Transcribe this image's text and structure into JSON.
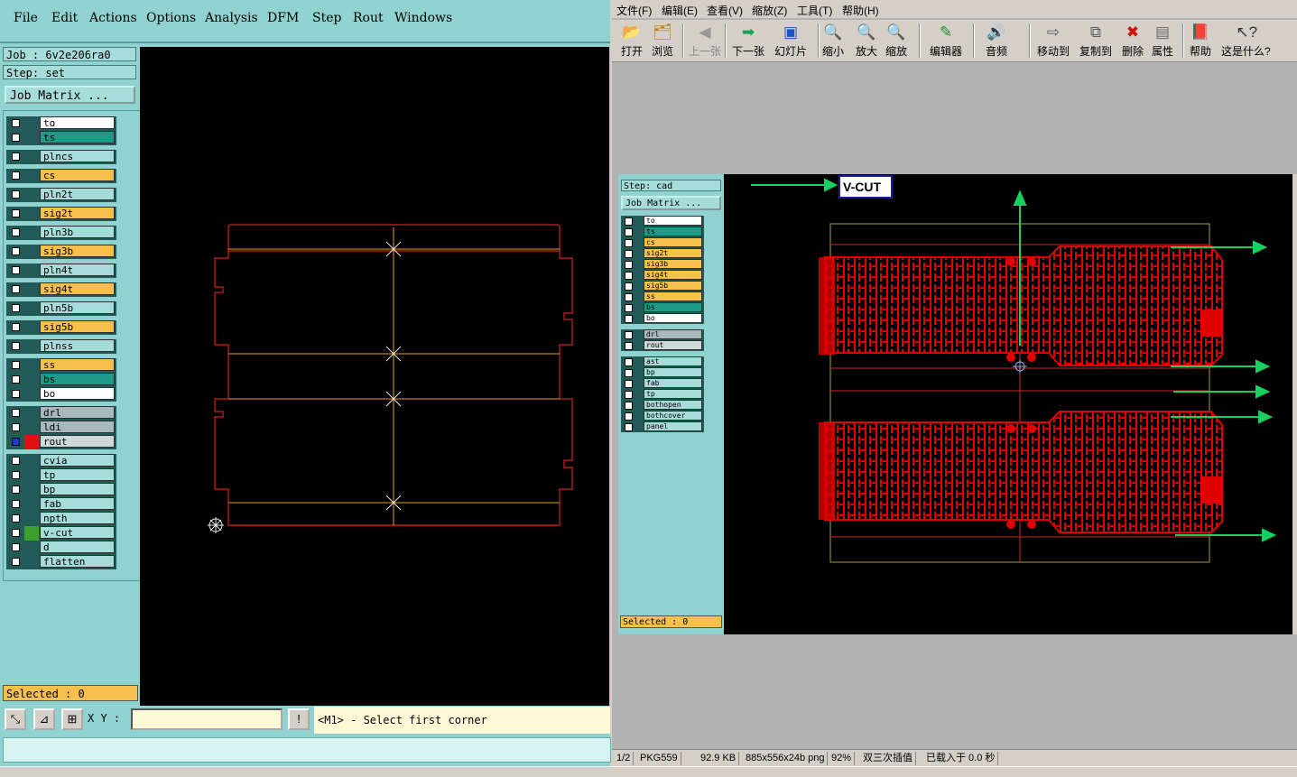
{
  "left_app": {
    "menu": [
      "File",
      "Edit",
      "Actions",
      "Options",
      "Analysis",
      "DFM",
      "Step",
      "Rout",
      "Windows"
    ],
    "job_line": "Job : 6v2e206ra0",
    "step_line": "Step: set",
    "job_matrix_button": "Job Matrix ...",
    "layer_groups": [
      [
        {
          "name": "to",
          "color": "#ffffff"
        },
        {
          "name": "ts",
          "color": "#1e9a86"
        }
      ],
      [
        {
          "name": "plncs",
          "color": "#a6dcda"
        }
      ],
      [
        {
          "name": "cs",
          "color": "#f7c04c"
        }
      ],
      [
        {
          "name": "pln2t",
          "color": "#a6dcda"
        }
      ],
      [
        {
          "name": "sig2t",
          "color": "#f7c04c"
        }
      ],
      [
        {
          "name": "pln3b",
          "color": "#a6dcda"
        }
      ],
      [
        {
          "name": "sig3b",
          "color": "#f7c04c"
        }
      ],
      [
        {
          "name": "pln4t",
          "color": "#a6dcda"
        }
      ],
      [
        {
          "name": "sig4t",
          "color": "#f7c04c"
        }
      ],
      [
        {
          "name": "pln5b",
          "color": "#a6dcda"
        }
      ],
      [
        {
          "name": "sig5b",
          "color": "#f7c04c"
        }
      ],
      [
        {
          "name": "plnss",
          "color": "#a6dcda"
        }
      ],
      [
        {
          "name": "ss",
          "color": "#f7c04c"
        },
        {
          "name": "bs",
          "color": "#1e9a86"
        },
        {
          "name": "bo",
          "color": "#ffffff"
        }
      ],
      [
        {
          "name": "drl",
          "color": "#a9b8bc"
        },
        {
          "name": "ldi",
          "color": "#a9b8bc"
        },
        {
          "name": "rout",
          "color": "#cfd8d8",
          "active": true
        }
      ],
      [
        {
          "name": "cvia",
          "color": "#a6dcda"
        },
        {
          "name": "tp",
          "color": "#a6dcda"
        },
        {
          "name": "bp",
          "color": "#a6dcda"
        },
        {
          "name": "fab",
          "color": "#a6dcda"
        },
        {
          "name": "npth",
          "color": "#a6dcda"
        },
        {
          "name": "v-cut",
          "color": "#a6dcda",
          "marker": "#3aa02a"
        },
        {
          "name": "d",
          "color": "#a6dcda"
        },
        {
          "name": "flatten",
          "color": "#a6dcda"
        }
      ]
    ],
    "selected_text": "Selected : 0",
    "xy_label": "X Y :",
    "exclaim": "!",
    "prompt_text": "<M1> - Select first corner"
  },
  "viewer": {
    "menu": [
      "文件(F)",
      "编辑(E)",
      "查看(V)",
      "缩放(Z)",
      "工具(T)",
      "帮助(H)"
    ],
    "toolbar": [
      {
        "label": "打开",
        "icon": "folder-open-icon",
        "glyph": "📂"
      },
      {
        "label": "浏览",
        "icon": "browse-icon",
        "glyph": "🗂"
      },
      {
        "label": "上一张",
        "icon": "prev-icon",
        "glyph": "◀",
        "disabled": true
      },
      {
        "label": "下一张",
        "icon": "next-icon",
        "glyph": "➡"
      },
      {
        "label": "幻灯片",
        "icon": "slideshow-icon",
        "glyph": "▣"
      },
      {
        "label": "缩小",
        "icon": "zoom-out-icon",
        "glyph": "🔍"
      },
      {
        "label": "放大",
        "icon": "zoom-in-icon",
        "glyph": "🔍"
      },
      {
        "label": "缩放",
        "icon": "zoom-icon",
        "glyph": "🔍"
      },
      {
        "label": "编辑器",
        "icon": "editor-icon",
        "glyph": "✎"
      },
      {
        "label": "音频",
        "icon": "audio-icon",
        "glyph": "🔊"
      },
      {
        "label": "移动到",
        "icon": "move-to-icon",
        "glyph": "⇨"
      },
      {
        "label": "复制到",
        "icon": "copy-to-icon",
        "glyph": "⧉"
      },
      {
        "label": "删除",
        "icon": "delete-icon",
        "glyph": "✖"
      },
      {
        "label": "属性",
        "icon": "properties-icon",
        "glyph": "▤"
      },
      {
        "label": "帮助",
        "icon": "help-book-icon",
        "glyph": "📕"
      },
      {
        "label": "这是什么?",
        "icon": "whats-this-icon",
        "glyph": "↖?"
      }
    ],
    "status": [
      "1/2",
      "PKG559",
      "92.9 KB",
      "885x556x24b png",
      "92%",
      "双三次插值",
      "已载入于 0.0 秒"
    ],
    "inner": {
      "step_line": "Step: cad",
      "job_matrix": "Job Matrix ...",
      "layers_a": [
        {
          "name": "to",
          "color": "#ffffff"
        },
        {
          "name": "ts",
          "color": "#1e9a86"
        },
        {
          "name": "cs",
          "color": "#f7c04c"
        },
        {
          "name": "sig2t",
          "color": "#f7c04c"
        },
        {
          "name": "sig3b",
          "color": "#f7c04c"
        },
        {
          "name": "sig4t",
          "color": "#f7c04c"
        },
        {
          "name": "sig5b",
          "color": "#f7c04c"
        },
        {
          "name": "ss",
          "color": "#f7c04c"
        },
        {
          "name": "bs",
          "color": "#1e9a86"
        },
        {
          "name": "bo",
          "color": "#ffffff"
        }
      ],
      "layers_b": [
        {
          "name": "drl",
          "color": "#a9b8bc"
        },
        {
          "name": "rout",
          "color": "#cfd8d8"
        }
      ],
      "layers_c": [
        {
          "name": "ast",
          "color": "#a6dcda"
        },
        {
          "name": "bp",
          "color": "#a6dcda"
        },
        {
          "name": "fab",
          "color": "#a6dcda"
        },
        {
          "name": "tp",
          "color": "#a6dcda"
        },
        {
          "name": "bothopen",
          "color": "#a6dcda"
        },
        {
          "name": "bothcover",
          "color": "#a6dcda"
        },
        {
          "name": "panel",
          "color": "#a6dcda"
        }
      ],
      "selected_text": "Selected : 0",
      "vcut_label": "V-CUT"
    }
  },
  "colors": {
    "teal_bg": "#8fd2d0",
    "outline_red": "#d42020",
    "vcut_line": "#e0a020",
    "arrow_green": "#18d060",
    "pcb_red": "#e00000"
  }
}
